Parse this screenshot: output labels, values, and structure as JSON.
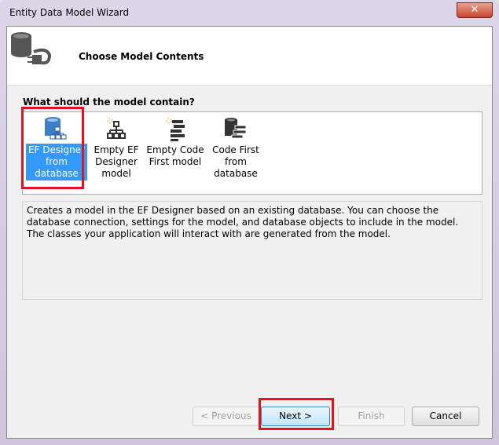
{
  "window": {
    "title": "Entity Data Model Wizard",
    "close_label": "✕"
  },
  "header": {
    "title": "Choose Model Contents",
    "icon": "database-plug-icon"
  },
  "prompt": "What should the model contain?",
  "options": [
    {
      "label": "EF Designer from database",
      "icon": "database-hierarchy-icon",
      "selected": true
    },
    {
      "label": "Empty EF Designer model",
      "icon": "hierarchy-sparkle-icon",
      "selected": false
    },
    {
      "label": "Empty Code First model",
      "icon": "code-first-sparkle-icon",
      "selected": false
    },
    {
      "label": "Code First from database",
      "icon": "database-code-icon",
      "selected": false
    }
  ],
  "description": "Creates a model in the EF Designer based on an existing database. You can choose the database connection, settings for the model, and database objects to include in the model. The classes your application will interact with are generated from the model.",
  "buttons": {
    "previous": "< Previous",
    "next": "Next >",
    "finish": "Finish",
    "cancel": "Cancel"
  },
  "colors": {
    "highlight": "#e0141e",
    "selection": "#3399ff"
  }
}
